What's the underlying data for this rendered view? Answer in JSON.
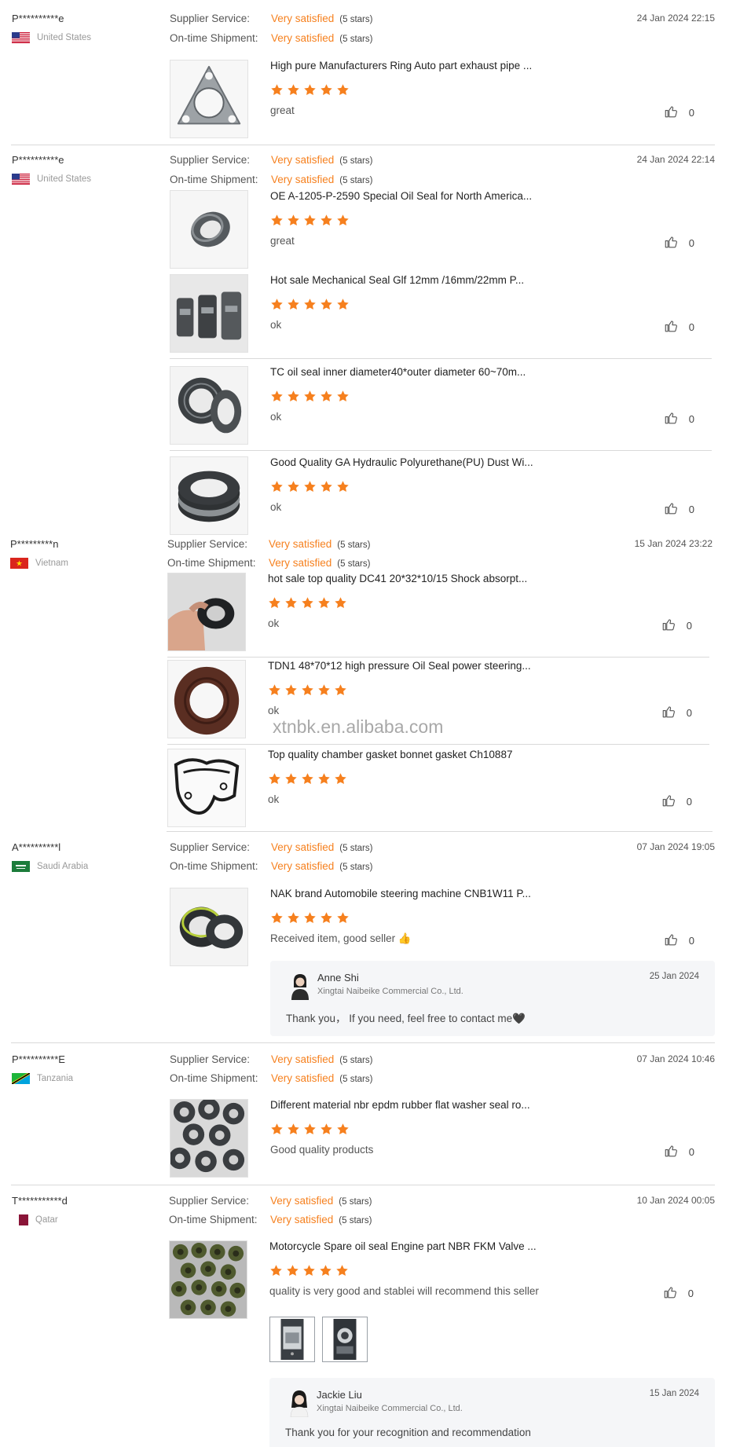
{
  "labels": {
    "supplier_service": "Supplier Service:",
    "ontime_shipment": "On-time Shipment:",
    "very_satisfied": "Very satisfied",
    "five_stars": "(5 stars)"
  },
  "colors": {
    "accent": "#f6801e",
    "star": "#f6801e",
    "separator": "#d9d9d9",
    "reply_bg": "#f5f6f8"
  },
  "watermark": "xtnbk.en.alibaba.com",
  "reviews": [
    {
      "buyer": "P**********e",
      "country": "United States",
      "flag": "us-flag-icon",
      "supplier_service": "Very satisfied",
      "supplier_stars": "(5 stars)",
      "shipment": "Very satisfied",
      "shipment_stars": "(5 stars)",
      "date": "24 Jan 2024 22:15",
      "products": [
        {
          "title": "High pure Manufacturers Ring Auto part exhaust pipe ...",
          "rating": 5,
          "comment": "great",
          "likes": "0",
          "image": "exhaust-gasket-image"
        }
      ]
    },
    {
      "buyer": "P**********e",
      "country": "United States",
      "flag": "us-flag-icon",
      "supplier_service": "Very satisfied",
      "supplier_stars": "(5 stars)",
      "shipment": "Very satisfied",
      "shipment_stars": "(5 stars)",
      "date": "24 Jan 2024 22:14",
      "products": [
        {
          "title": "OE A-1205-P-2590 Special Oil Seal for North America...",
          "rating": 5,
          "comment": "great",
          "likes": "0",
          "image": "oil-seal-image"
        },
        {
          "title": "Hot sale Mechanical Seal Glf 12mm /16mm/22mm P...",
          "rating": 5,
          "comment": "ok",
          "likes": "0",
          "image": "mechanical-seal-image"
        },
        {
          "title": "TC oil seal inner diameter40*outer diameter 60~70m...",
          "rating": 5,
          "comment": "ok",
          "likes": "0",
          "image": "tc-oil-seal-image"
        },
        {
          "title": "Good Quality GA Hydraulic Polyurethane(PU) Dust Wi...",
          "rating": 5,
          "comment": "ok",
          "likes": "0",
          "image": "dust-wiper-image"
        }
      ]
    },
    {
      "buyer": "P*********n",
      "country": "Vietnam",
      "flag": "vietnam-flag-icon",
      "supplier_service": "Very satisfied",
      "supplier_stars": "(5 stars)",
      "shipment": "Very satisfied",
      "shipment_stars": "(5 stars)",
      "date": "15 Jan 2024 23:22",
      "products": [
        {
          "title": "hot sale top quality DC41 20*32*10/15 Shock absorpt...",
          "rating": 5,
          "comment": "ok",
          "likes": "0",
          "image": "shock-seal-image"
        },
        {
          "title": "TDN1 48*70*12 high pressure Oil Seal power steering...",
          "rating": 5,
          "comment": "ok",
          "likes": "0",
          "image": "brown-oil-seal-image"
        },
        {
          "title": "Top quality chamber gasket bonnet gasket Ch10887",
          "rating": 5,
          "comment": "ok",
          "likes": "0",
          "image": "chamber-gasket-image"
        }
      ]
    },
    {
      "buyer": "A**********l",
      "country": "Saudi Arabia",
      "flag": "saudi-flag-icon",
      "supplier_service": "Very satisfied",
      "supplier_stars": "(5 stars)",
      "shipment": "Very satisfied",
      "shipment_stars": "(5 stars)",
      "date": "07 Jan 2024 19:05",
      "products": [
        {
          "title": "NAK brand Automobile steering machine CNB1W11 P...",
          "rating": 5,
          "comment": "Received item, good seller 👍",
          "likes": "0",
          "image": "steering-seal-image"
        }
      ],
      "reply": {
        "name": "Anne Shi",
        "company": "Xingtai Naibeike Commercial Co., Ltd.",
        "date": "25 Jan 2024",
        "text": "Thank you，  If you need, feel free to contact me🖤"
      }
    },
    {
      "buyer": "P**********E",
      "country": "Tanzania",
      "flag": "tanzania-flag-icon",
      "supplier_service": "Very satisfied",
      "supplier_stars": "(5 stars)",
      "shipment": "Very satisfied",
      "shipment_stars": "(5 stars)",
      "date": "07 Jan 2024 10:46",
      "products": [
        {
          "title": "Different material nbr epdm rubber flat washer seal ro...",
          "rating": 5,
          "comment": "Good quality products",
          "likes": "0",
          "image": "washer-seal-image"
        }
      ]
    },
    {
      "buyer": "T***********d",
      "country": "Qatar",
      "flag": "qatar-flag-icon",
      "supplier_service": "Very satisfied",
      "supplier_stars": "(5 stars)",
      "shipment": "Very satisfied",
      "shipment_stars": "(5 stars)",
      "date": "10 Jan 2024 00:05",
      "products": [
        {
          "title": "Motorcycle Spare oil seal Engine part NBR FKM Valve ...",
          "rating": 5,
          "comment": "quality is very good and stablei will recommend this seller",
          "likes": "0",
          "image": "valve-seal-image"
        }
      ],
      "photos": [
        "buyer-photo-1",
        "buyer-photo-2"
      ],
      "reply": {
        "name": "Jackie Liu",
        "company": "Xingtai Naibeike Commercial Co., Ltd.",
        "date": "15 Jan 2024",
        "text": "Thank you for your recognition and recommendation"
      }
    }
  ]
}
